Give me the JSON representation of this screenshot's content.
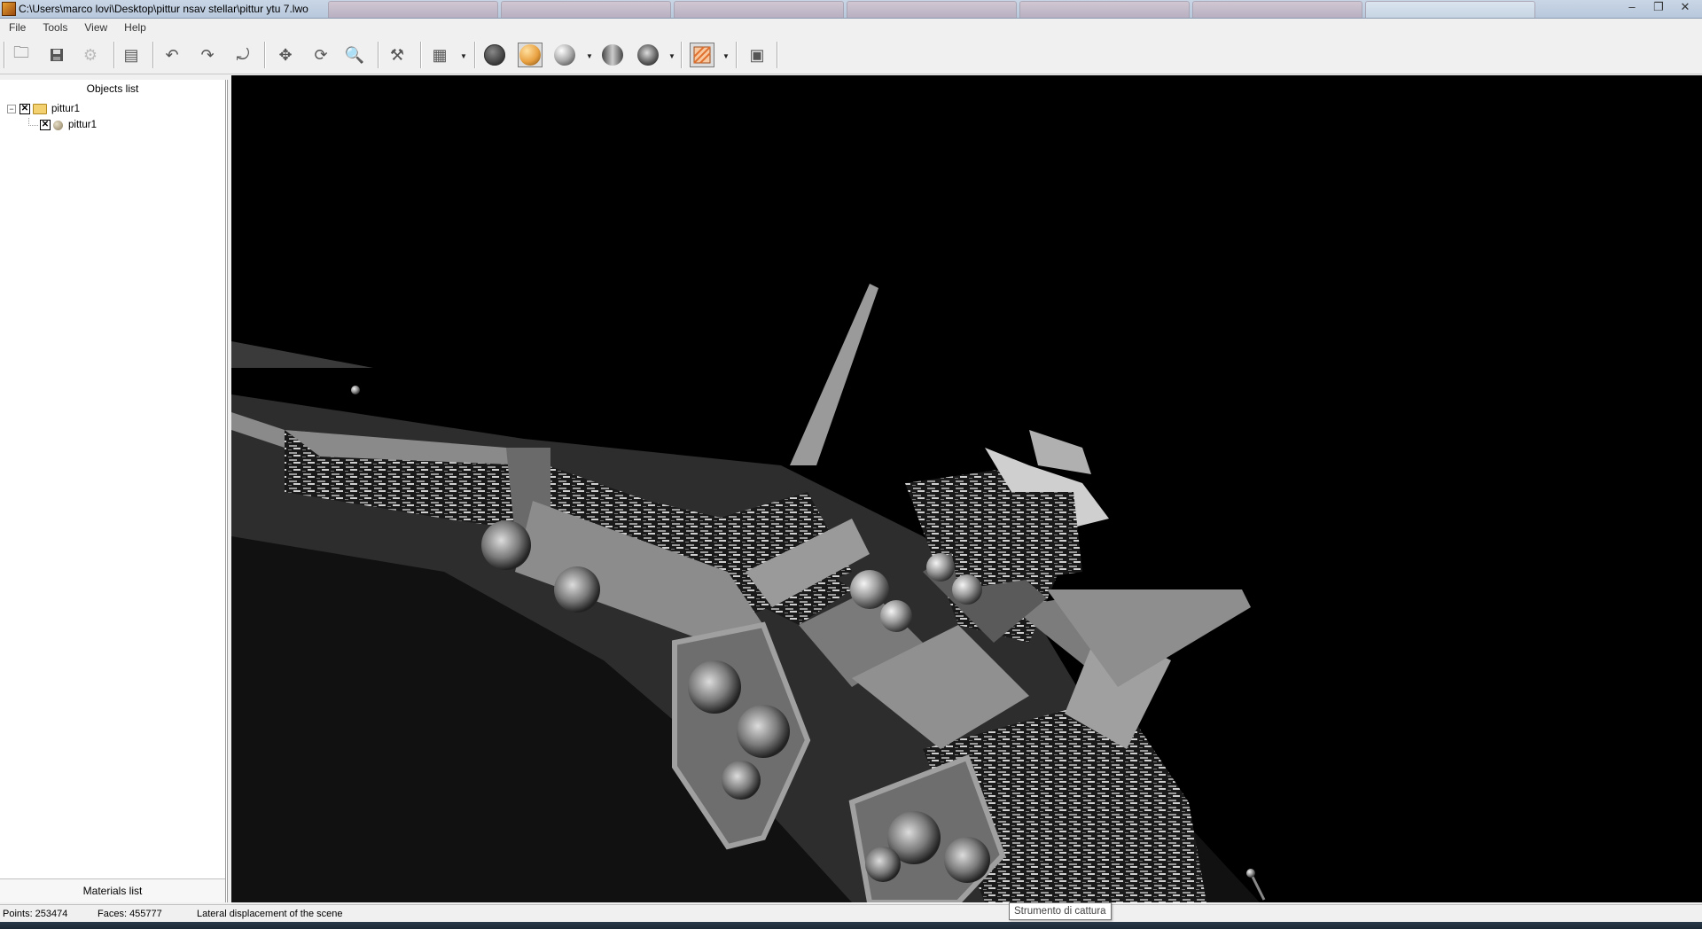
{
  "window": {
    "title": "C:\\Users\\marco lovi\\Desktop\\pittur nsav stellar\\pittur ytu 7.lwo",
    "controls": {
      "minimize": "–",
      "restore": "❐",
      "close": "✕"
    }
  },
  "menu": {
    "items": [
      {
        "label": "File"
      },
      {
        "label": "Tools"
      },
      {
        "label": "View"
      },
      {
        "label": "Help"
      }
    ]
  },
  "toolbar": {
    "buttons": [
      {
        "name": "open-icon",
        "glyph": "🗀"
      },
      {
        "name": "save-icon",
        "glyph": "💾"
      },
      {
        "name": "settings-gear-icon",
        "glyph": "⚙"
      },
      {
        "name": "layers-icon",
        "glyph": "▤"
      },
      {
        "name": "undo-icon",
        "glyph": "↶"
      },
      {
        "name": "redo-icon",
        "glyph": "↷"
      },
      {
        "name": "reset-view-icon",
        "glyph": "⤾"
      },
      {
        "name": "move-icon",
        "glyph": "✥"
      },
      {
        "name": "rotate-icon",
        "glyph": "⟳"
      },
      {
        "name": "zoom-icon",
        "glyph": "🔍"
      },
      {
        "name": "tools-hammer-icon",
        "glyph": "⚒"
      },
      {
        "name": "grid-toggle-icon",
        "glyph": "▦"
      },
      {
        "name": "wireframe-sphere-icon",
        "glyph": ""
      },
      {
        "name": "solid-orange-sphere-icon",
        "glyph": ""
      },
      {
        "name": "gray-sphere-icon",
        "glyph": ""
      },
      {
        "name": "flat-sphere-icon",
        "glyph": ""
      },
      {
        "name": "smooth-sphere-icon",
        "glyph": ""
      },
      {
        "name": "texture-icon",
        "glyph": ""
      },
      {
        "name": "screenshot-icon",
        "glyph": "▣"
      }
    ],
    "colors": {
      "orange_sphere": "#e8a040",
      "texture_accent": "#e07030"
    }
  },
  "objects_panel": {
    "header": "Objects list",
    "tree": [
      {
        "label": "pittur1",
        "level": 0,
        "checked": true,
        "icon": "folder-icon"
      },
      {
        "label": "pittur1",
        "level": 1,
        "checked": true,
        "icon": "sphere-object-icon"
      }
    ]
  },
  "materials_panel": {
    "header": "Materials list"
  },
  "statusbar": {
    "points": "Points: 253474",
    "faces": "Faces: 455777",
    "hint": "Lateral displacement of the scene"
  },
  "tooltip": {
    "text": "Strumento di cattura"
  },
  "viewport": {
    "background": "#000000",
    "model_color": "#8c8c8c"
  }
}
